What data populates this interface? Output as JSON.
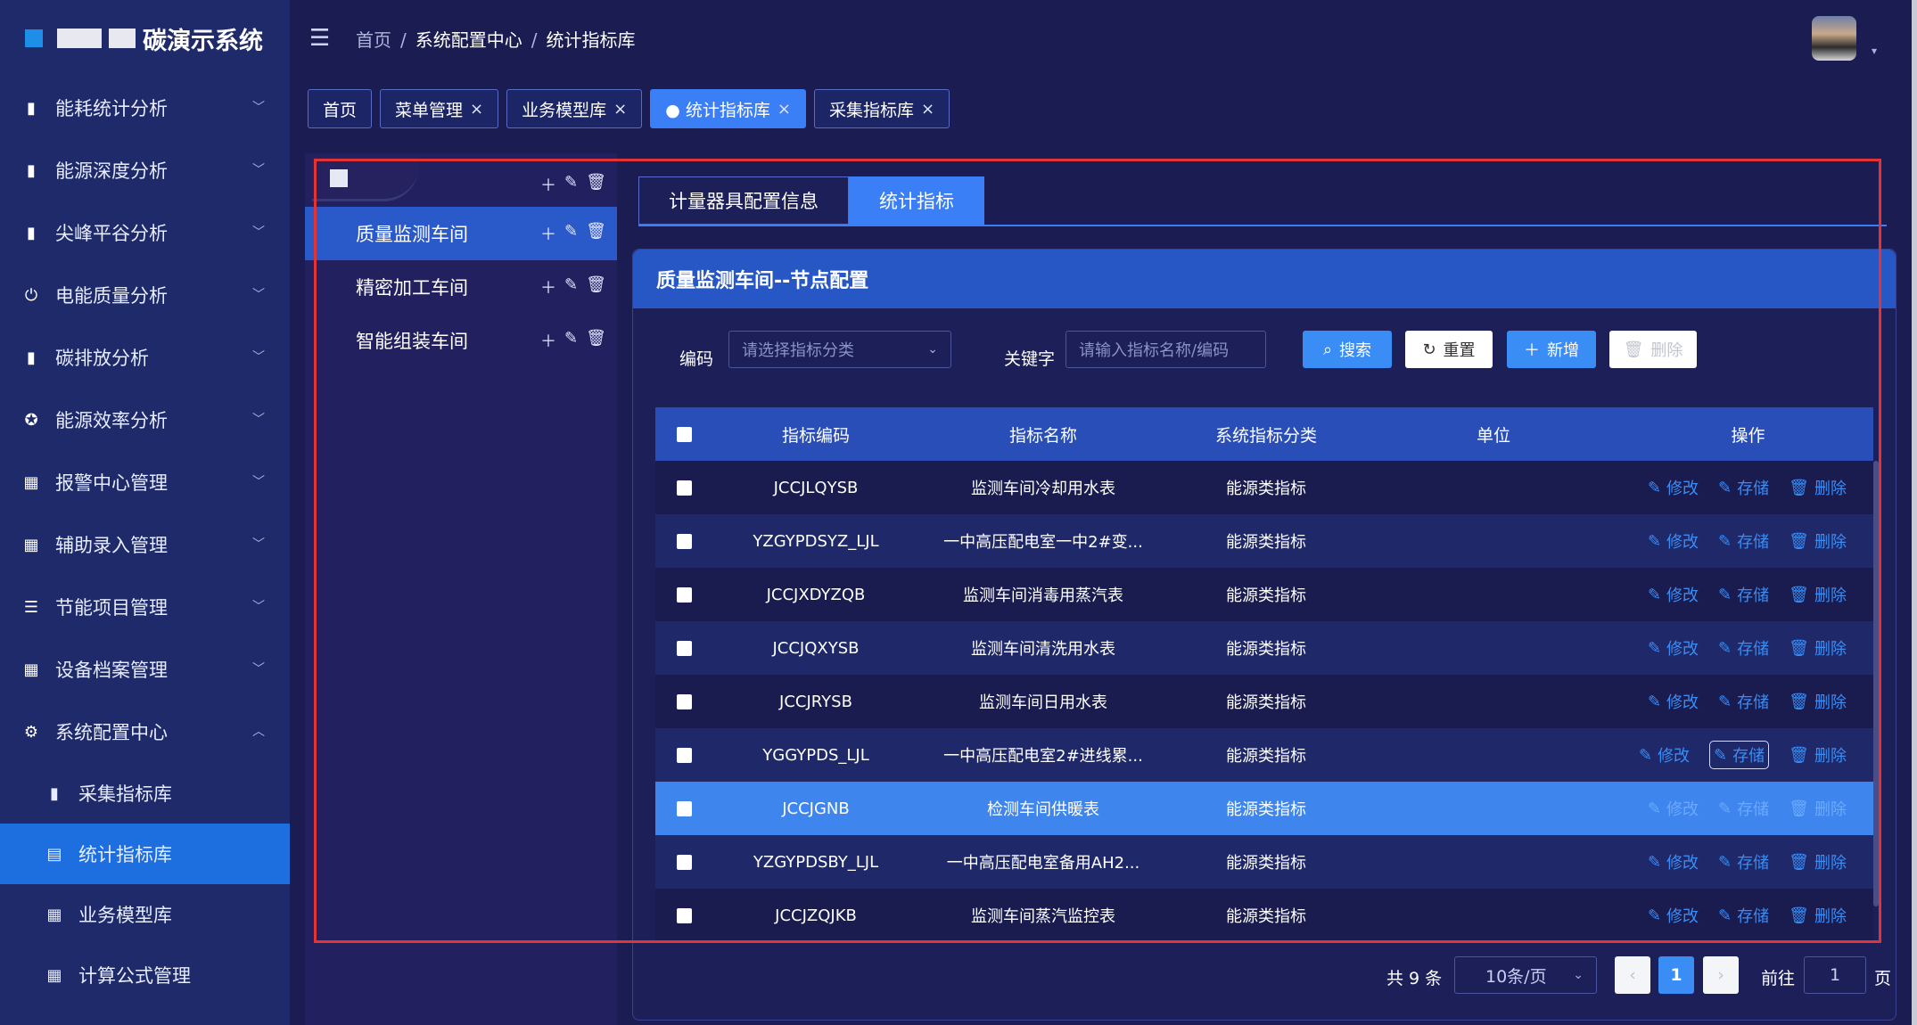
{
  "app": {
    "title_suffix": "碳演示系统"
  },
  "header": {
    "breadcrumb": [
      "首页",
      "系统配置中心",
      "统计指标库"
    ]
  },
  "sidebar": {
    "items": [
      {
        "label": "能耗统计分析",
        "icon": "bar-chart-icon"
      },
      {
        "label": "能源深度分析",
        "icon": "bar-chart-icon"
      },
      {
        "label": "尖峰平谷分析",
        "icon": "bar-chart-icon"
      },
      {
        "label": "电能质量分析",
        "icon": "plug-icon"
      },
      {
        "label": "碳排放分析",
        "icon": "bar-chart-icon"
      },
      {
        "label": "能源效率分析",
        "icon": "gauge-icon"
      },
      {
        "label": "报警中心管理",
        "icon": "grid-icon"
      },
      {
        "label": "辅助录入管理",
        "icon": "grid-icon"
      },
      {
        "label": "节能项目管理",
        "icon": "list-icon"
      },
      {
        "label": "设备档案管理",
        "icon": "grid-icon"
      },
      {
        "label": "系统配置中心",
        "icon": "gear-icon"
      }
    ],
    "sub_items": [
      {
        "label": "采集指标库",
        "icon": "bar-chart-icon"
      },
      {
        "label": "统计指标库",
        "icon": "document-icon"
      },
      {
        "label": "业务模型库",
        "icon": "grid-icon"
      },
      {
        "label": "计算公式管理",
        "icon": "grid-icon"
      }
    ]
  },
  "tabs": [
    {
      "label": "首页"
    },
    {
      "label": "菜单管理"
    },
    {
      "label": "业务模型库"
    },
    {
      "label": "● 统计指标库"
    },
    {
      "label": "采集指标库"
    }
  ],
  "tree": {
    "nodes": [
      {
        "label": "质量监测车间"
      },
      {
        "label": "精密加工车间"
      },
      {
        "label": "智能组装车间"
      }
    ]
  },
  "content_tabs": [
    "计量器具配置信息",
    "统计指标"
  ],
  "card": {
    "title": "质量监测车间--节点配置"
  },
  "filter": {
    "code_label": "编码",
    "code_placeholder": "请选择指标分类",
    "keyword_label": "关键字",
    "keyword_placeholder": "请输入指标名称/编码",
    "search": "搜索",
    "reset": "重置",
    "add": "新增",
    "delete": "删除"
  },
  "table": {
    "headers": [
      "指标编码",
      "指标名称",
      "系统指标分类",
      "单位",
      "操作"
    ],
    "rows": [
      {
        "code": "JCCJLQYSB",
        "name": "监测车间冷却用水表",
        "category": "能源类指标",
        "unit": ""
      },
      {
        "code": "YZGYPDSYZ_LJL",
        "name": "一中高压配电室一中2#变...",
        "category": "能源类指标",
        "unit": ""
      },
      {
        "code": "JCCJXDYZQB",
        "name": "监测车间消毒用蒸汽表",
        "category": "能源类指标",
        "unit": ""
      },
      {
        "code": "JCCJQXYSB",
        "name": "监测车间清洗用水表",
        "category": "能源类指标",
        "unit": ""
      },
      {
        "code": "JCCJRYSB",
        "name": "监测车间日用水表",
        "category": "能源类指标",
        "unit": ""
      },
      {
        "code": "YGGYPDS_LJL",
        "name": "一中高压配电室2#进线累...",
        "category": "能源类指标",
        "unit": ""
      },
      {
        "code": "JCCJGNB",
        "name": "检测车间供暖表",
        "category": "能源类指标",
        "unit": ""
      },
      {
        "code": "YZGYPDSBY_LJL",
        "name": "一中高压配电室备用AH2...",
        "category": "能源类指标",
        "unit": ""
      },
      {
        "code": "JCCJZQJKB",
        "name": "监测车间蒸汽监控表",
        "category": "能源类指标",
        "unit": ""
      }
    ],
    "actions": {
      "edit": "修改",
      "store": "存储",
      "delete": "删除"
    }
  },
  "pagination": {
    "total": "共 9 条",
    "page_size": "10条/页",
    "prev": "‹",
    "current": "1",
    "next": "›",
    "goto_label": "前往",
    "goto_value": "1",
    "page_suffix": "页"
  },
  "colors": {
    "accent": "#3a7ff5",
    "sidebar_bg": "#1e2a6a",
    "page_bg": "#1b1d52",
    "annotation": "#e43333"
  }
}
